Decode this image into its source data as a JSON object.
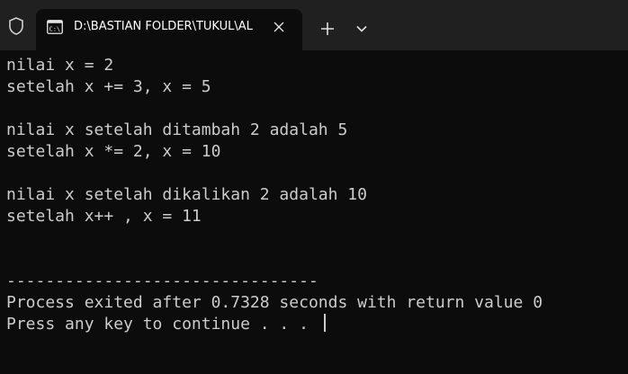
{
  "titlebar": {
    "tab_title": "D:\\BASTIAN FOLDER\\TUKUL\\AL",
    "tab_icon_text": "C:\\"
  },
  "console": {
    "lines": [
      "nilai x = 2",
      "setelah x += 3, x = 5",
      "",
      "nilai x setelah ditambah 2 adalah 5",
      "setelah x *= 2, x = 10",
      "",
      "nilai x setelah dikalikan 2 adalah 10",
      "setelah x++ , x = 11",
      "",
      "",
      "--------------------------------",
      "Process exited after 0.7328 seconds with return value 0",
      "Press any key to continue . . . "
    ]
  },
  "colors": {
    "terminal_bg": "#0c0c0c",
    "titlebar_bg": "#202020",
    "text": "#cccccc"
  }
}
